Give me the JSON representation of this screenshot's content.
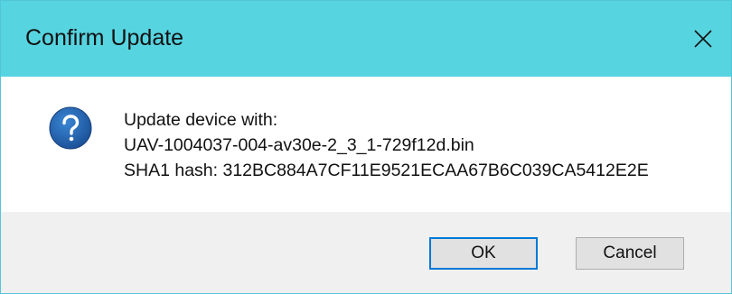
{
  "window": {
    "title": "Confirm Update",
    "close_icon": "close-icon"
  },
  "message": {
    "icon": "question-icon",
    "lines": [
      "Update device with:",
      "UAV-1004037-004-av30e-2_3_1-729f12d.bin",
      "SHA1 hash: 312BC884A7CF11E9521ECAA67B6C039CA5412E2E"
    ]
  },
  "buttons": {
    "ok_label": "OK",
    "cancel_label": "Cancel"
  },
  "colors": {
    "titlebar": "#56d4e0",
    "accent_focus": "#0078d7",
    "icon_blue": "#1f5faa",
    "footer": "#f0f0f0"
  }
}
